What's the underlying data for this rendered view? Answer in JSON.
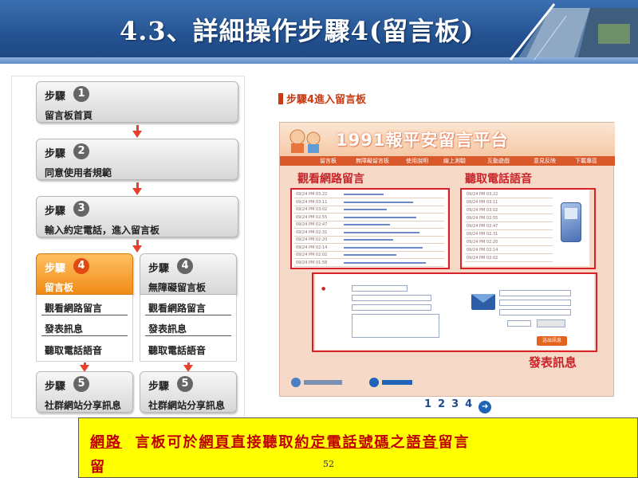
{
  "header": {
    "title": "4.3、詳細操作步驟4(留言板)"
  },
  "steps": {
    "step_word": "步驟",
    "items": [
      {
        "num": "1",
        "desc": "留言板首頁"
      },
      {
        "num": "2",
        "desc": "同意使用者規範"
      },
      {
        "num": "3",
        "desc": "輸入約定電話，進入留言板"
      }
    ],
    "options": [
      {
        "num": "4",
        "desc": "留言板",
        "list": [
          "觀看網路留言",
          "發表訊息",
          "聽取電話語音"
        ]
      },
      {
        "num": "4",
        "desc": "無障礙留言板",
        "list": [
          "觀看網路留言",
          "發表訊息",
          "聽取電話語音"
        ]
      }
    ],
    "share": [
      {
        "num": "5",
        "desc": "社群網站分享訊息"
      },
      {
        "num": "5",
        "desc": "社群網站分享訊息"
      }
    ]
  },
  "screenshot": {
    "heading_step": "步驟4",
    "heading_text": "進入留言板",
    "logo": "1991報平安留言平台",
    "nav": [
      "留言板",
      "無障礙留言板",
      "使用說明",
      "線上測驗",
      "互動遊戲",
      "意見反映",
      "下載專區"
    ],
    "view_title": "觀看網路留言",
    "listen_title": "聽取電話語音",
    "post_title": "發表訊息",
    "submit_label": "送出訊息",
    "dates": [
      "09/24 PM 03:22",
      "09/24 PM 03:11",
      "09/24 PM 03:02",
      "09/24 PM 02:55",
      "09/24 PM 02:47",
      "09/24 PM 02:31",
      "09/24 PM 02:20",
      "09/24 PM 02:14",
      "09/24 PM 02:02",
      "09/24 PM 01:58"
    ]
  },
  "pager": {
    "pages": [
      "1",
      "2",
      "3",
      "4"
    ],
    "next_icon": "arrow-right-circle-icon"
  },
  "banner": {
    "part1": "網路",
    "part2": "言板可於",
    "part3": "網頁",
    "part4": "直接聽取",
    "part5": "約定電話號碼",
    "part6": "之",
    "part7": "語音",
    "part8": "留言",
    "cont": "留"
  },
  "footer": {
    "page_number": "52"
  },
  "colors": {
    "header_blue": "#23518f",
    "accent_orange": "#f08b17",
    "alert_red": "#d8222a",
    "banner_yellow": "#ffff00"
  }
}
